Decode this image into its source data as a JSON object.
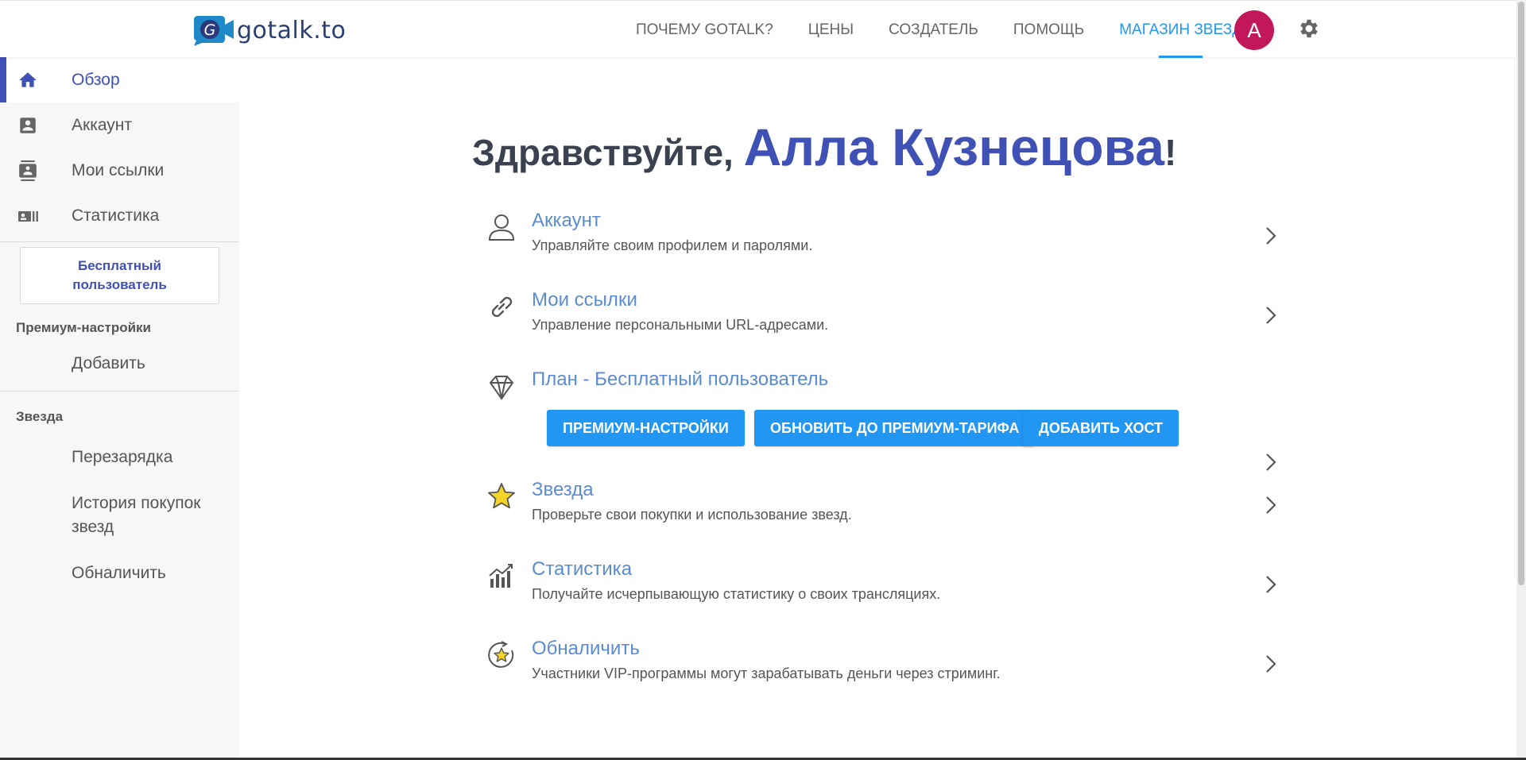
{
  "brand": {
    "name": "gotalk.to",
    "logo_letter": "G"
  },
  "nav": {
    "items": [
      "ПОЧЕМУ GOTALK?",
      "ЦЕНЫ",
      "СОЗДАТЕЛЬ",
      "ПОМОЩЬ",
      "МАГАЗИН ЗВЕЗД"
    ],
    "active": "МАГАЗИН ЗВЕЗД",
    "avatar_letter": "А",
    "accent": "#2196f3",
    "avatar_color": "#c2185b"
  },
  "sidebar": {
    "items": [
      {
        "label": "Обзор",
        "icon": "home-icon",
        "active": true
      },
      {
        "label": "Аккаунт",
        "icon": "account-box-icon",
        "active": false
      },
      {
        "label": "Мои ссылки",
        "icon": "contacts-icon",
        "active": false
      },
      {
        "label": "Статистика",
        "icon": "stats-card-icon",
        "active": false
      }
    ],
    "plan_label": "Бесплатный пользователь",
    "premium_section": "Премиум-настройки",
    "premium_add": "Добавить",
    "star_section": "Звезда",
    "star_items": [
      "Перезарядка",
      "История покупок звезд",
      "Обналичить"
    ],
    "accent": "#3f51b5"
  },
  "main": {
    "greeting_prefix": "Здравствуйте, ",
    "user_name": "Алла Кузнецова",
    "greeting_suffix": "!",
    "rows": [
      {
        "title": "Аккаунт",
        "desc": "Управляйте своим профилем и паролями.",
        "icon": "person-outline-icon"
      },
      {
        "title": "Мои ссылки",
        "desc": "Управление персональными URL-адресами.",
        "icon": "link-icon"
      },
      {
        "title": "План - Бесплатный пользователь",
        "desc": "",
        "icon": "diamond-icon"
      },
      {
        "title": "Звезда",
        "desc": "Проверьте свои покупки и использование звезд.",
        "icon": "star-icon"
      },
      {
        "title": "Статистика",
        "desc": "Получайте исчерпывающую статистику о своих трансляциях.",
        "icon": "chart-icon"
      },
      {
        "title": "Обналичить",
        "desc": "Участники VIP-программы могут зарабатывать деньги через стриминг.",
        "icon": "cashout-star-icon"
      }
    ],
    "buttons": [
      "ПРЕМИУМ-НАСТРОЙКИ",
      "ОБНОВИТЬ ДО ПРЕМИУМ-ТАРИФА",
      "ДОБАВИТЬ ХОСТ"
    ],
    "title_color": "#5b8bd0"
  }
}
